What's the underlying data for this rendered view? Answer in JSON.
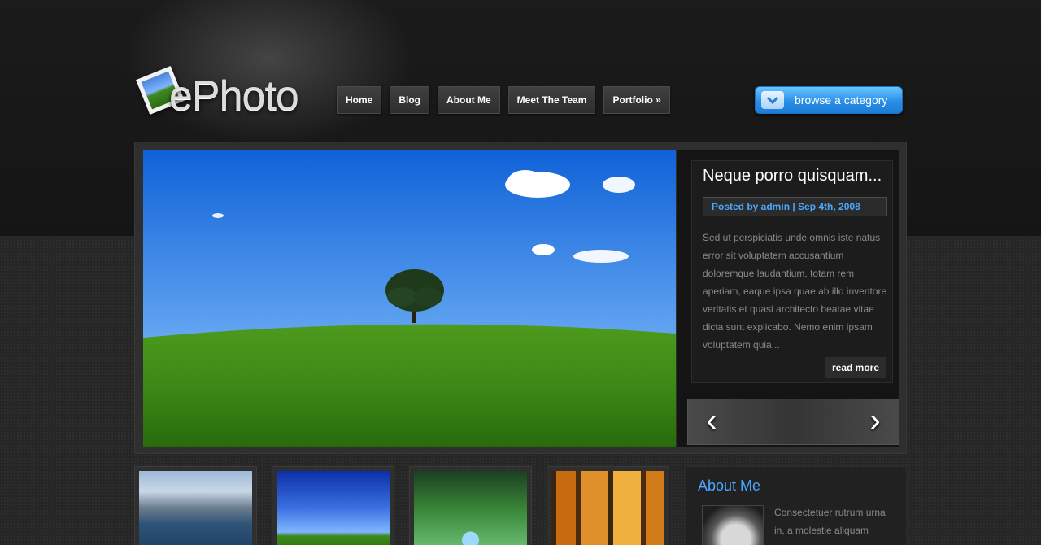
{
  "site": {
    "logo_text": "ePhoto"
  },
  "nav": {
    "items": [
      {
        "label": "Home"
      },
      {
        "label": "Blog"
      },
      {
        "label": "About Me"
      },
      {
        "label": "Meet The Team"
      },
      {
        "label": "Portfolio »"
      }
    ]
  },
  "browse": {
    "label": "browse a category",
    "icon": "chevron-down-icon"
  },
  "featured": {
    "title": "Neque porro quisquam...",
    "meta": "Posted by admin | Sep 4th, 2008",
    "excerpt": "Sed ut perspiciatis unde omnis iste natus error sit voluptatem accusantium doloremque laudantium, totam rem aperiam, eaque ipsa quae ab illo inventore veritatis et quasi architecto beatae vitae dicta sunt explicabo. Nemo enim ipsam voluptatem quia...",
    "read_more": "read more",
    "prev_icon": "‹",
    "next_icon": "›"
  },
  "about": {
    "title": "About Me",
    "text": "Consectetuer rutrum urna in, a molestie aliquam"
  },
  "colors": {
    "accent": "#4aa8ff",
    "button_blue": "#2a8fe8",
    "background": "#1a1a1a"
  }
}
